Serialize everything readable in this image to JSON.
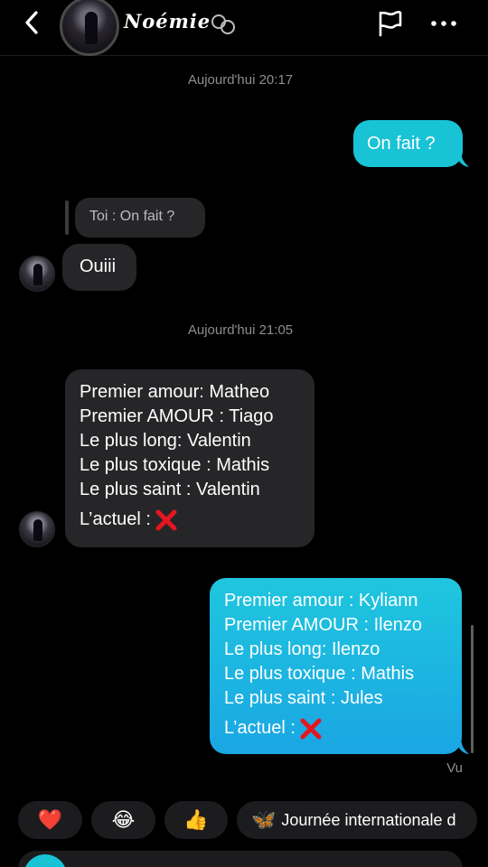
{
  "header": {
    "contact_name": "Noémie"
  },
  "timestamps": [
    "Aujourd'hui 20:17",
    "Aujourd'hui 21:05"
  ],
  "messages": {
    "m1": "On fait ?",
    "quote": "Toi : On fait ?",
    "m2": "Ouiii",
    "m3": {
      "lines": [
        "Premier amour: Matheo",
        "Premier AMOUR : Tiago",
        "Le plus long: Valentin",
        "Le plus toxique : Mathis",
        "Le plus saint : Valentin"
      ],
      "last": "L’actuel :"
    },
    "m4": {
      "lines": [
        "Premier amour : Kyliann",
        "Premier AMOUR : Ilenzo",
        "Le plus long: Ilenzo",
        "Le plus toxique : Mathis",
        "Le plus saint : Jules"
      ],
      "last": "L’actuel :"
    }
  },
  "seen_label": "Vu",
  "reactions": {
    "heart": "❤️",
    "laugh": "😂",
    "thumbs": "👍",
    "butterfly": "🦋",
    "event_label": "Journée internationale d"
  },
  "colors": {
    "outgoing": "#19c3d6",
    "incoming": "#262628",
    "background": "#000000",
    "x_mark": "#e5161f"
  },
  "icons": [
    "back-chevron-icon",
    "rings-icon",
    "flag-icon",
    "more-icon",
    "x-mark-icon"
  ]
}
